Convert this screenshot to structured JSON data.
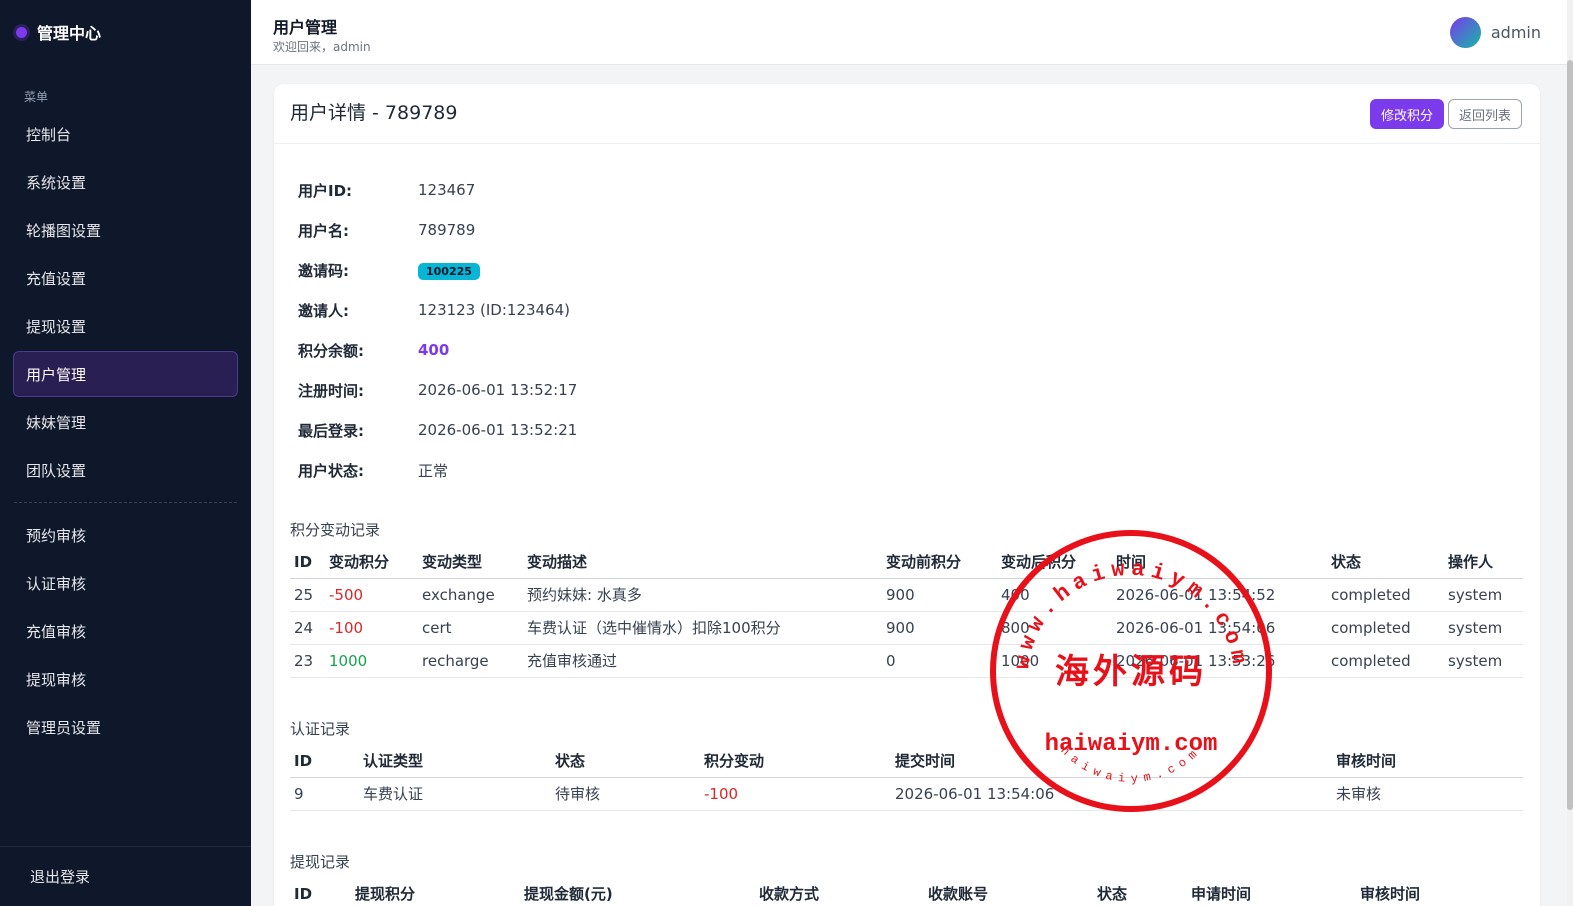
{
  "brand": "管理中心",
  "sidebar": {
    "section_label": "菜单",
    "items": [
      {
        "label": "控制台"
      },
      {
        "label": "系统设置"
      },
      {
        "label": "轮播图设置"
      },
      {
        "label": "充值设置"
      },
      {
        "label": "提现设置"
      },
      {
        "label": "用户管理"
      },
      {
        "label": "妹妹管理"
      },
      {
        "label": "团队设置"
      }
    ],
    "items2": [
      {
        "label": "预约审核"
      },
      {
        "label": "认证审核"
      },
      {
        "label": "充值审核"
      },
      {
        "label": "提现审核"
      },
      {
        "label": "管理员设置"
      }
    ],
    "logout": "退出登录"
  },
  "header": {
    "title": "用户管理",
    "subtitle": "欢迎回来，admin",
    "username": "admin"
  },
  "card": {
    "title": "用户详情 - 789789",
    "edit_button": "修改积分",
    "back_button": "返回列表"
  },
  "info": {
    "user_id_label": "用户ID:",
    "user_id": "123467",
    "username_label": "用户名:",
    "username": "789789",
    "invite_code_label": "邀请码:",
    "invite_code": "100225",
    "inviter_label": "邀请人:",
    "inviter": "123123 (ID:123464)",
    "balance_label": "积分余额:",
    "balance": "400",
    "register_label": "注册时间:",
    "register_time": "2026-06-01 13:52:17",
    "last_login_label": "最后登录:",
    "last_login": "2026-06-01 13:52:21",
    "status_label": "用户状态:",
    "status": "正常"
  },
  "points_log": {
    "title": "积分变动记录",
    "headers": [
      "ID",
      "变动积分",
      "变动类型",
      "变动描述",
      "变动前积分",
      "变动后积分",
      "时间",
      "状态",
      "操作人"
    ],
    "rows": [
      {
        "id": "25",
        "change": "-500",
        "type": "exchange",
        "desc": "预约妹妹: 水真多",
        "before": "900",
        "after": "400",
        "time": "2026-06-01 13:54:52",
        "status": "completed",
        "operator": "system"
      },
      {
        "id": "24",
        "change": "-100",
        "type": "cert",
        "desc": "车费认证（选中催情水）扣除100积分",
        "before": "900",
        "after": "800",
        "time": "2026-06-01 13:54:06",
        "status": "completed",
        "operator": "system"
      },
      {
        "id": "23",
        "change": "1000",
        "type": "recharge",
        "desc": "充值审核通过",
        "before": "0",
        "after": "1000",
        "time": "2026-06-01 13:53:26",
        "status": "completed",
        "operator": "system"
      }
    ]
  },
  "cert_log": {
    "title": "认证记录",
    "headers": [
      "ID",
      "认证类型",
      "状态",
      "积分变动",
      "提交时间",
      "审核时间"
    ],
    "rows": [
      {
        "id": "9",
        "type": "车费认证",
        "status": "待审核",
        "change": "-100",
        "submit_time": "2026-06-01 13:54:06",
        "review_time": "未审核"
      }
    ]
  },
  "withdraw_log": {
    "title": "提现记录",
    "headers": [
      "ID",
      "提现积分",
      "提现金额(元)",
      "收款方式",
      "收款账号",
      "状态",
      "申请时间",
      "审核时间"
    ]
  },
  "watermark": {
    "top_arc": "www.haiwaiym.com",
    "center": "海外源码",
    "domain": "haiwaiym.com",
    "bottom_arc": "haiwaiym.com",
    "color": "#e8111a"
  }
}
